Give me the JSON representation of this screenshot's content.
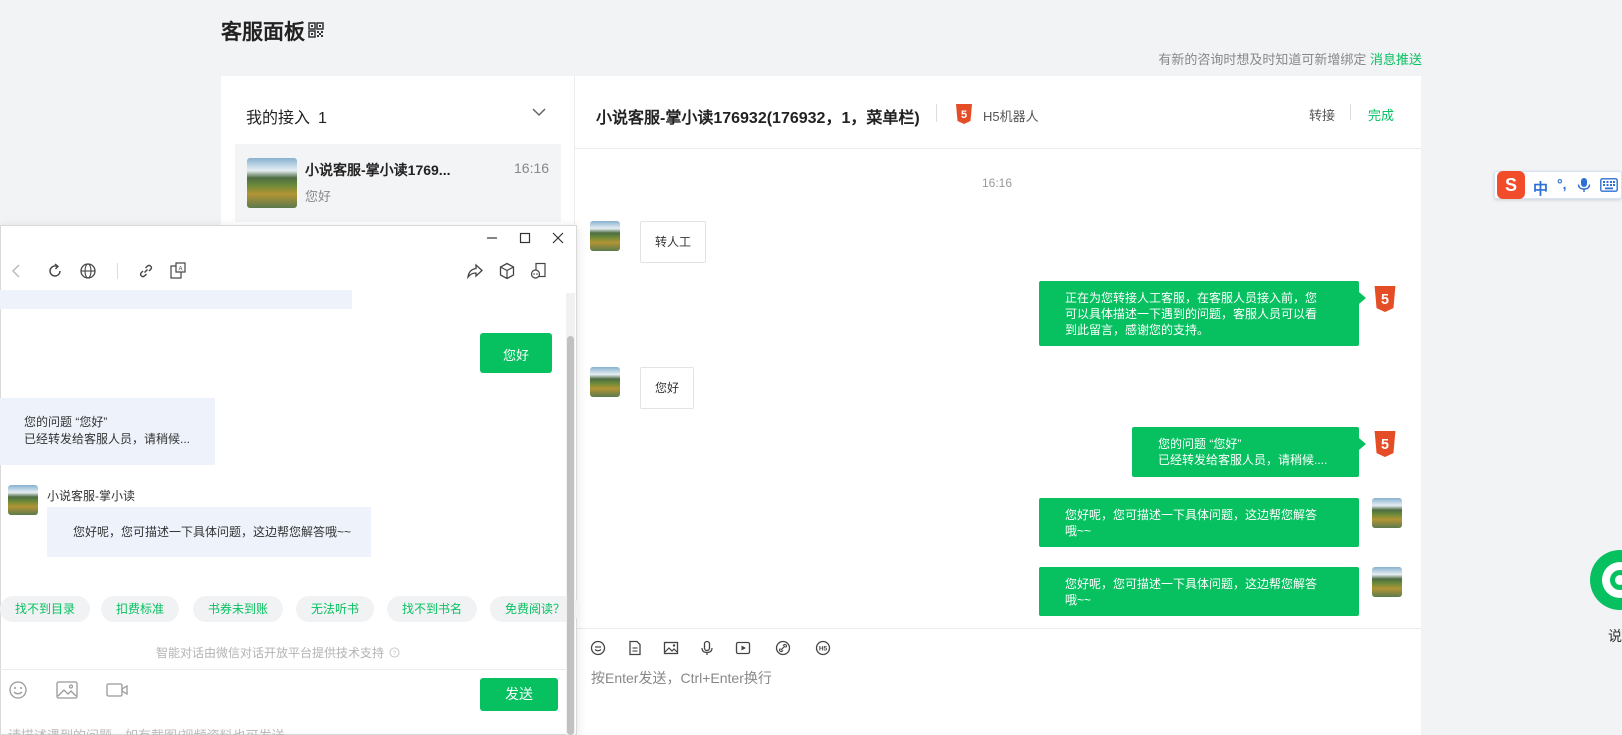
{
  "page": {
    "title": "客服面板",
    "tip_text": "有新的咨询时想及时知道可新增绑定",
    "tip_link": "消息推送"
  },
  "session_list": {
    "header": "我的接入",
    "count": "1",
    "items": [
      {
        "name": "小说客服-掌小读1769...",
        "time": "16:16",
        "last_message": "您好"
      }
    ]
  },
  "chat": {
    "title": "小说客服-掌小读176932(176932，1，菜单栏)",
    "robot_label": "H5机器人",
    "action_transfer": "转接",
    "action_done": "完成",
    "time_divider": "16:16",
    "messages": [
      {
        "side": "in",
        "text": "转人工"
      },
      {
        "side": "out",
        "sender": "h5",
        "lines": [
          "正在为您转接人工客服，在客服人员接入前，您",
          "可以具体描述一下遇到的问题，客服人员可以看",
          "到此留言，感谢您的支持。"
        ]
      },
      {
        "side": "in",
        "text": "您好"
      },
      {
        "side": "out",
        "sender": "h5",
        "lines": [
          "您的问题 “您好”",
          "已经转发给客服人员，请稍候...."
        ]
      },
      {
        "side": "out",
        "sender": "agent",
        "lines": [
          "您好呢，您可描述一下具体问题，这边帮您解答",
          "哦~~"
        ]
      },
      {
        "side": "out",
        "sender": "agent",
        "lines": [
          "您好呢，您可描述一下具体问题，这边帮您解答",
          "哦~~"
        ]
      }
    ],
    "composer_hint": "按Enter发送，Ctrl+Enter换行",
    "h5_badge": "5"
  },
  "preview_window": {
    "sent_message": "您好",
    "system_message_lines": [
      "您的问题 “您好”",
      "已经转发给客服人员，请稍候..."
    ],
    "agent_name": "小说客服-掌小读",
    "agent_message": "您好呢，您可描述一下具体问题，这边帮您解答哦~~",
    "chips": [
      "找不到目录",
      "扣费标准",
      "书券未到账",
      "无法听书",
      "找不到书名",
      "免费阅读？"
    ],
    "tech_note": "智能对话由微信对话开放平台提供技术支持",
    "send_button": "发送",
    "input_hint": "请描述遇到的问题，如有截图/视频资料也可发送"
  },
  "ime": {
    "logo": "S",
    "mode": "中",
    "punctuation": "°,"
  },
  "side_widget": {
    "label": "说"
  },
  "colors": {
    "accent": "#07c160",
    "h5_badge": "#e44d26"
  }
}
